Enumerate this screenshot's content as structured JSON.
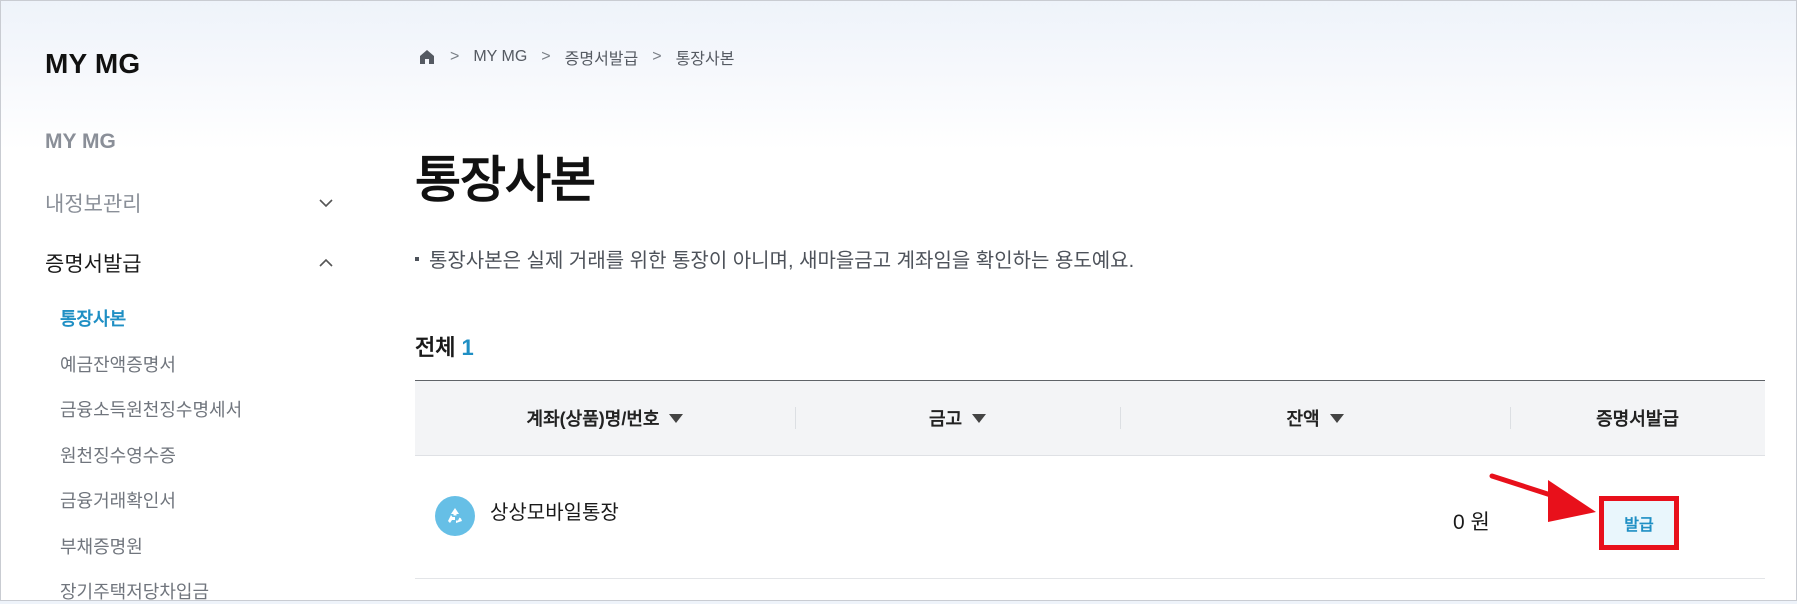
{
  "sidebar": {
    "logo": "MY MG",
    "top_item": "MY MG",
    "groups": [
      {
        "label": "내정보관리",
        "expanded": false
      },
      {
        "label": "증명서발급",
        "expanded": true
      }
    ],
    "sub_items": [
      "통장사본",
      "예금잔액증명서",
      "금융소득원천징수명세서",
      "원천징수영수증",
      "금융거래확인서",
      "부채증명원",
      "장기주택저당차입금"
    ]
  },
  "breadcrumb": {
    "home_icon": "home-icon",
    "items": [
      "MY MG",
      "증명서발급",
      "통장사본"
    ],
    "separator": ">"
  },
  "page": {
    "title": "통장사본",
    "notice": "통장사본은 실제 거래를 위한 통장이 아니며, 새마을금고 계좌임을 확인하는 용도예요."
  },
  "summary": {
    "label": "전체",
    "count": "1"
  },
  "table": {
    "headers": [
      "계좌(상품)명/번호",
      "금고",
      "잔액",
      "증명서발급"
    ],
    "rows": [
      {
        "account_name": "상상모바일통장",
        "branch": "",
        "balance": "0 원",
        "action": "발급"
      }
    ]
  },
  "colors": {
    "accent": "#1f8fc4",
    "highlight": "#e8101b",
    "account_icon": "#66bfe6"
  }
}
